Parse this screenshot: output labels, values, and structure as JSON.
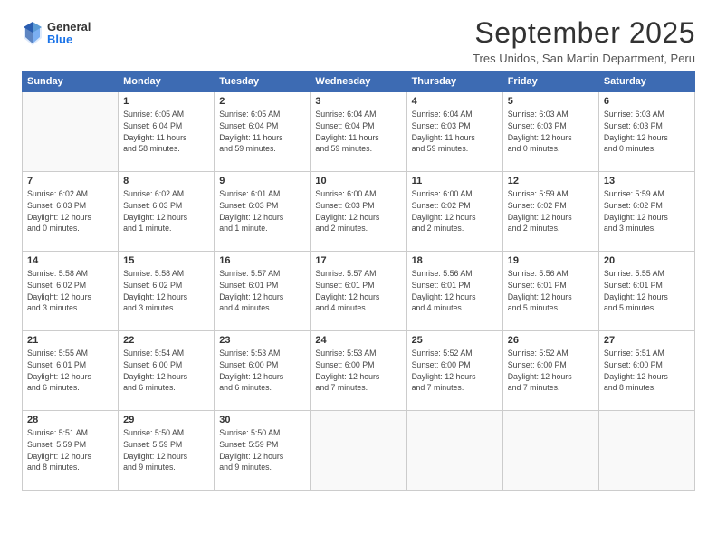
{
  "logo": {
    "general": "General",
    "blue": "Blue"
  },
  "title": "September 2025",
  "location": "Tres Unidos, San Martin Department, Peru",
  "headers": [
    "Sunday",
    "Monday",
    "Tuesday",
    "Wednesday",
    "Thursday",
    "Friday",
    "Saturday"
  ],
  "days": [
    {
      "num": "",
      "info": ""
    },
    {
      "num": "1",
      "info": "Sunrise: 6:05 AM\nSunset: 6:04 PM\nDaylight: 11 hours\nand 58 minutes."
    },
    {
      "num": "2",
      "info": "Sunrise: 6:05 AM\nSunset: 6:04 PM\nDaylight: 11 hours\nand 59 minutes."
    },
    {
      "num": "3",
      "info": "Sunrise: 6:04 AM\nSunset: 6:04 PM\nDaylight: 11 hours\nand 59 minutes."
    },
    {
      "num": "4",
      "info": "Sunrise: 6:04 AM\nSunset: 6:03 PM\nDaylight: 11 hours\nand 59 minutes."
    },
    {
      "num": "5",
      "info": "Sunrise: 6:03 AM\nSunset: 6:03 PM\nDaylight: 12 hours\nand 0 minutes."
    },
    {
      "num": "6",
      "info": "Sunrise: 6:03 AM\nSunset: 6:03 PM\nDaylight: 12 hours\nand 0 minutes."
    },
    {
      "num": "7",
      "info": "Sunrise: 6:02 AM\nSunset: 6:03 PM\nDaylight: 12 hours\nand 0 minutes."
    },
    {
      "num": "8",
      "info": "Sunrise: 6:02 AM\nSunset: 6:03 PM\nDaylight: 12 hours\nand 1 minute."
    },
    {
      "num": "9",
      "info": "Sunrise: 6:01 AM\nSunset: 6:03 PM\nDaylight: 12 hours\nand 1 minute."
    },
    {
      "num": "10",
      "info": "Sunrise: 6:00 AM\nSunset: 6:03 PM\nDaylight: 12 hours\nand 2 minutes."
    },
    {
      "num": "11",
      "info": "Sunrise: 6:00 AM\nSunset: 6:02 PM\nDaylight: 12 hours\nand 2 minutes."
    },
    {
      "num": "12",
      "info": "Sunrise: 5:59 AM\nSunset: 6:02 PM\nDaylight: 12 hours\nand 2 minutes."
    },
    {
      "num": "13",
      "info": "Sunrise: 5:59 AM\nSunset: 6:02 PM\nDaylight: 12 hours\nand 3 minutes."
    },
    {
      "num": "14",
      "info": "Sunrise: 5:58 AM\nSunset: 6:02 PM\nDaylight: 12 hours\nand 3 minutes."
    },
    {
      "num": "15",
      "info": "Sunrise: 5:58 AM\nSunset: 6:02 PM\nDaylight: 12 hours\nand 3 minutes."
    },
    {
      "num": "16",
      "info": "Sunrise: 5:57 AM\nSunset: 6:01 PM\nDaylight: 12 hours\nand 4 minutes."
    },
    {
      "num": "17",
      "info": "Sunrise: 5:57 AM\nSunset: 6:01 PM\nDaylight: 12 hours\nand 4 minutes."
    },
    {
      "num": "18",
      "info": "Sunrise: 5:56 AM\nSunset: 6:01 PM\nDaylight: 12 hours\nand 4 minutes."
    },
    {
      "num": "19",
      "info": "Sunrise: 5:56 AM\nSunset: 6:01 PM\nDaylight: 12 hours\nand 5 minutes."
    },
    {
      "num": "20",
      "info": "Sunrise: 5:55 AM\nSunset: 6:01 PM\nDaylight: 12 hours\nand 5 minutes."
    },
    {
      "num": "21",
      "info": "Sunrise: 5:55 AM\nSunset: 6:01 PM\nDaylight: 12 hours\nand 6 minutes."
    },
    {
      "num": "22",
      "info": "Sunrise: 5:54 AM\nSunset: 6:00 PM\nDaylight: 12 hours\nand 6 minutes."
    },
    {
      "num": "23",
      "info": "Sunrise: 5:53 AM\nSunset: 6:00 PM\nDaylight: 12 hours\nand 6 minutes."
    },
    {
      "num": "24",
      "info": "Sunrise: 5:53 AM\nSunset: 6:00 PM\nDaylight: 12 hours\nand 7 minutes."
    },
    {
      "num": "25",
      "info": "Sunrise: 5:52 AM\nSunset: 6:00 PM\nDaylight: 12 hours\nand 7 minutes."
    },
    {
      "num": "26",
      "info": "Sunrise: 5:52 AM\nSunset: 6:00 PM\nDaylight: 12 hours\nand 7 minutes."
    },
    {
      "num": "27",
      "info": "Sunrise: 5:51 AM\nSunset: 6:00 PM\nDaylight: 12 hours\nand 8 minutes."
    },
    {
      "num": "28",
      "info": "Sunrise: 5:51 AM\nSunset: 5:59 PM\nDaylight: 12 hours\nand 8 minutes."
    },
    {
      "num": "29",
      "info": "Sunrise: 5:50 AM\nSunset: 5:59 PM\nDaylight: 12 hours\nand 9 minutes."
    },
    {
      "num": "30",
      "info": "Sunrise: 5:50 AM\nSunset: 5:59 PM\nDaylight: 12 hours\nand 9 minutes."
    },
    {
      "num": "",
      "info": ""
    },
    {
      "num": "",
      "info": ""
    },
    {
      "num": "",
      "info": ""
    },
    {
      "num": "",
      "info": ""
    }
  ]
}
